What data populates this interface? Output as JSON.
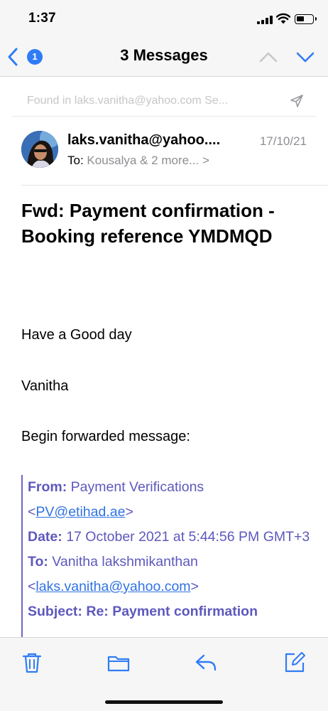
{
  "status_bar": {
    "time": "1:37"
  },
  "nav": {
    "back_badge": "1",
    "title": "3 Messages"
  },
  "search_banner": {
    "text": "Found in laks.vanitha@yahoo.com Se..."
  },
  "message": {
    "sender": "laks.vanitha@yahoo....",
    "date": "17/10/21",
    "to_label": "To:",
    "to_value": "Kousalya & 2 more... >",
    "subject": "Fwd: Payment confirmation - Booking reference YMDMQD",
    "body": {
      "greeting": "Have a Good day",
      "signature": "Vanitha",
      "forward_intro": "Begin forwarded message:"
    },
    "forwarded": {
      "from_label": "From:",
      "from_name": "Payment Verifications",
      "from_email": "PV@etihad.ae",
      "date_label": "Date:",
      "date_value": "17 October 2021 at 5:44:56 PM GMT+3",
      "to_label": "To:",
      "to_name": "Vanitha lakshmikanthan",
      "to_email": "laks.vanitha@yahoo.com",
      "subject_label": "Subject:",
      "subject_value": "Re: Payment confirmation"
    }
  },
  "toolbar": {
    "icons": [
      "trash-icon",
      "folder-icon",
      "reply-icon",
      "compose-icon"
    ]
  },
  "colors": {
    "accent": "#2f7cf6",
    "quote": "#5e58bd",
    "link": "#2f73e4",
    "secondary_text": "#8e8e93"
  }
}
